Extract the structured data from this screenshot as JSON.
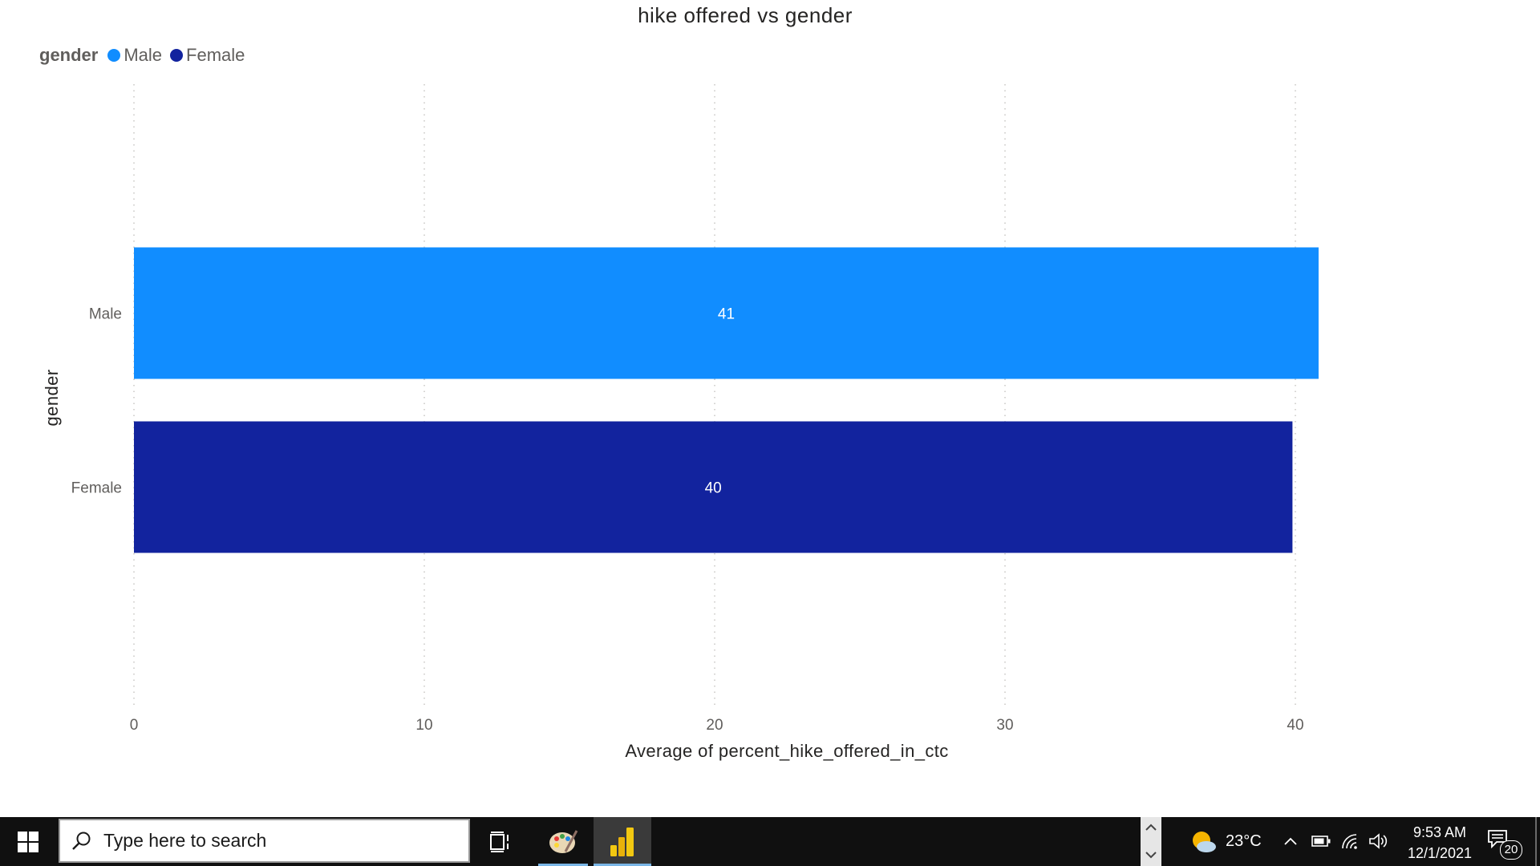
{
  "chart_data": {
    "type": "bar",
    "orientation": "horizontal",
    "title": "hike offered vs gender",
    "xlabel": "Average of percent_hike_offered_in_ctc",
    "ylabel": "gender",
    "categories": [
      "Male",
      "Female"
    ],
    "values": [
      40.8,
      39.9
    ],
    "data_labels": [
      "41",
      "40"
    ],
    "colors": [
      "#118DFF",
      "#12239E"
    ],
    "xlim": [
      0,
      40
    ],
    "xticks": [
      "0",
      "10",
      "20",
      "30",
      "40"
    ],
    "grid": true,
    "legend": {
      "title": "gender",
      "position": "top-left",
      "entries": [
        {
          "name": "Male",
          "color": "#118DFF"
        },
        {
          "name": "Female",
          "color": "#12239E"
        }
      ]
    }
  },
  "taskbar": {
    "search_placeholder": "Type here to search",
    "weather_temp": "23°C",
    "time": "9:53 AM",
    "date": "12/1/2021",
    "notification_count": "20"
  }
}
